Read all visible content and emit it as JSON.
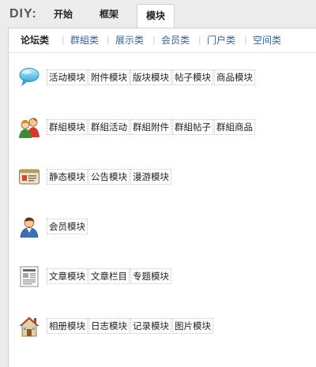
{
  "header": {
    "logo": "DIY:",
    "tabs": [
      {
        "label": "开始"
      },
      {
        "label": "框架"
      },
      {
        "label": "模块",
        "active": true
      }
    ]
  },
  "subtabs": [
    {
      "label": "论坛类",
      "active": true
    },
    {
      "label": "群組类"
    },
    {
      "label": "展示类"
    },
    {
      "label": "会员类"
    },
    {
      "label": "门户类"
    },
    {
      "label": "空间类"
    }
  ],
  "categories": [
    {
      "icon": "speech-bubble-icon",
      "items": [
        "活动模块",
        "附件模块",
        "版块模块",
        "帖子模块",
        "商品模块"
      ]
    },
    {
      "icon": "group-users-icon",
      "items": [
        "群組模块",
        "群組活动",
        "群組附件",
        "群組帖子",
        "群組商品"
      ]
    },
    {
      "icon": "billboard-icon",
      "items": [
        "静态模块",
        "公告模块",
        "漫游模块"
      ]
    },
    {
      "icon": "member-user-icon",
      "items": [
        "会员模块"
      ]
    },
    {
      "icon": "article-document-icon",
      "items": [
        "文章模块",
        "文章栏目",
        "专题模块"
      ]
    },
    {
      "icon": "home-house-icon",
      "items": [
        "相册模块",
        "日志模块",
        "记录模块",
        "图片模块"
      ]
    }
  ],
  "colors": {
    "link": "#336699",
    "background": "#ececec",
    "panel": "#ffffff"
  }
}
